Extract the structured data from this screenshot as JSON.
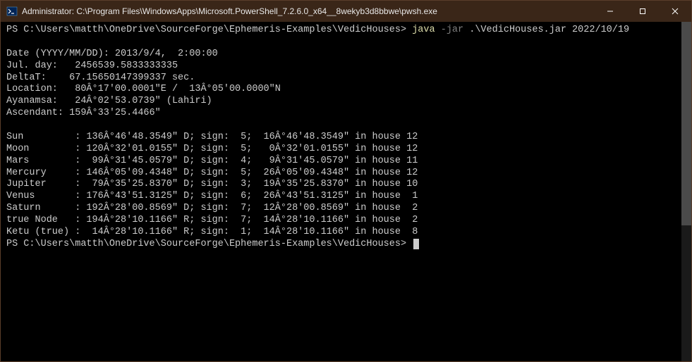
{
  "titlebar": {
    "icon": "powershell-icon",
    "title": "Administrator: C:\\Program Files\\WindowsApps\\Microsoft.PowerShell_7.2.6.0_x64__8wekyb3d8bbwe\\pwsh.exe"
  },
  "window_controls": {
    "minimize": "—",
    "maximize": "☐",
    "close": "✕"
  },
  "terminal": {
    "prompt1": "PS C:\\Users\\matth\\OneDrive\\SourceForge\\Ephemeris-Examples\\VedicHouses>",
    "cmd_java": "java",
    "cmd_flag": "-jar",
    "cmd_args": ".\\VedicHouses.jar 2022/10/19",
    "output": [
      "Date (YYYY/MM/DD): 2013/9/4,  2:00:00",
      "Jul. day:   2456539.5833333335",
      "DeltaT:    67.15650147399337 sec.",
      "Location:   80Â°17'00.0001\"E /  13Â°05'00.0000\"N",
      "Ayanamsa:   24Â°02'53.0739\" (Lahiri)",
      "Ascendant: 159Â°33'25.4466\"",
      "",
      "Sun         : 136Â°46'48.3549\" D; sign:  5;  16Â°46'48.3549\" in house 12",
      "Moon        : 120Â°32'01.0155\" D; sign:  5;   0Â°32'01.0155\" in house 12",
      "Mars        :  99Â°31'45.0579\" D; sign:  4;   9Â°31'45.0579\" in house 11",
      "Mercury     : 146Â°05'09.4348\" D; sign:  5;  26Â°05'09.4348\" in house 12",
      "Jupiter     :  79Â°35'25.8370\" D; sign:  3;  19Â°35'25.8370\" in house 10",
      "Venus       : 176Â°43'51.3125\" D; sign:  6;  26Â°43'51.3125\" in house  1",
      "Saturn      : 192Â°28'00.8569\" D; sign:  7;  12Â°28'00.8569\" in house  2",
      "true Node   : 194Â°28'10.1166\" R; sign:  7;  14Â°28'10.1166\" in house  2",
      "Ketu (true) :  14Â°28'10.1166\" R; sign:  1;  14Â°28'10.1166\" in house  8"
    ],
    "prompt2": "PS C:\\Users\\matth\\OneDrive\\SourceForge\\Ephemeris-Examples\\VedicHouses>"
  }
}
